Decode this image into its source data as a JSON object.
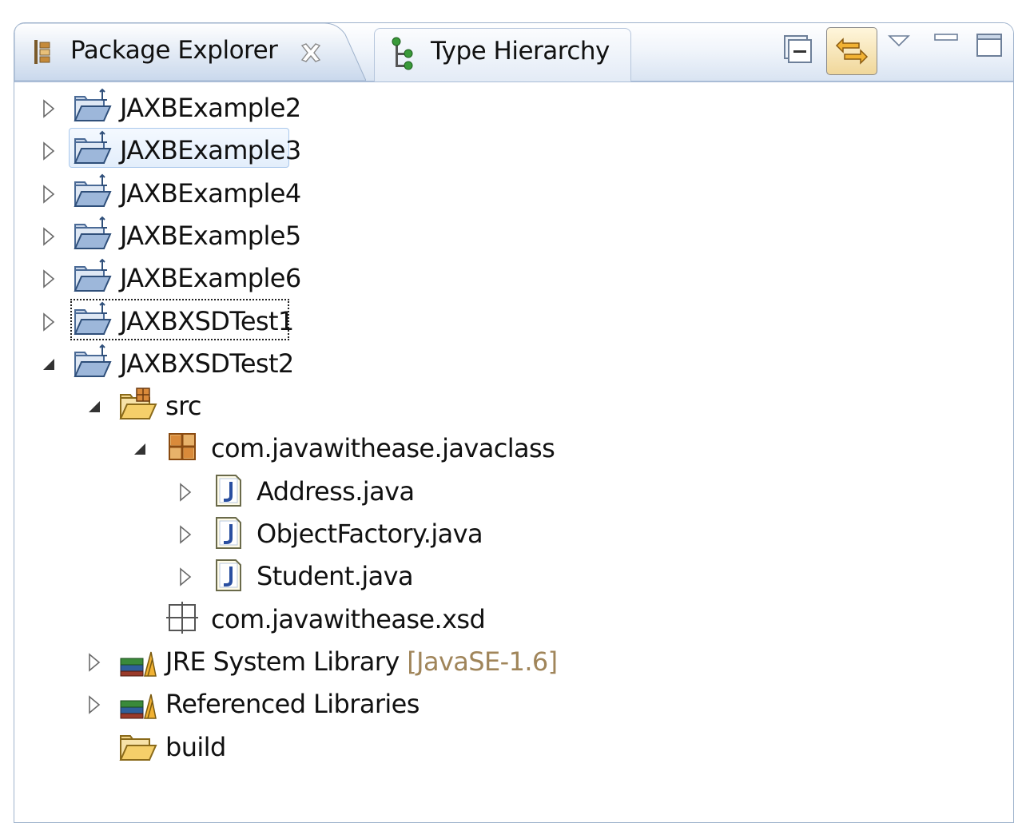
{
  "tabs": [
    {
      "label": "Package Explorer",
      "active": true
    },
    {
      "label": "Type Hierarchy",
      "active": false
    }
  ],
  "toolbar": {
    "collapse_all": "collapse-all-icon",
    "link_with_editor": "link-with-editor-icon",
    "view_menu": "view-menu-icon",
    "minimize": "minimize-icon",
    "maximize": "maximize-icon"
  },
  "tree": [
    {
      "label": "JAXBExample2",
      "icon": "project-folder-icon",
      "expanded": false,
      "depth": 0
    },
    {
      "label": "JAXBExample3",
      "icon": "project-folder-icon",
      "expanded": false,
      "depth": 0,
      "hover": true
    },
    {
      "label": "JAXBExample4",
      "icon": "project-folder-icon",
      "expanded": false,
      "depth": 0
    },
    {
      "label": "JAXBExample5",
      "icon": "project-folder-icon",
      "expanded": false,
      "depth": 0
    },
    {
      "label": "JAXBExample6",
      "icon": "project-folder-icon",
      "expanded": false,
      "depth": 0
    },
    {
      "label": "JAXBXSDTest1",
      "icon": "project-folder-icon",
      "expanded": false,
      "depth": 0,
      "focused": true
    },
    {
      "label": "JAXBXSDTest2",
      "icon": "project-folder-icon",
      "expanded": true,
      "depth": 0
    },
    {
      "label": "src",
      "icon": "source-folder-icon",
      "expanded": true,
      "depth": 1
    },
    {
      "label": "com.javawithease.javaclass",
      "icon": "package-icon",
      "expanded": true,
      "depth": 2
    },
    {
      "label": "Address.java",
      "icon": "java-file-icon",
      "expanded": false,
      "depth": 3
    },
    {
      "label": "ObjectFactory.java",
      "icon": "java-file-icon",
      "expanded": false,
      "depth": 3
    },
    {
      "label": "Student.java",
      "icon": "java-file-icon",
      "expanded": false,
      "depth": 3
    },
    {
      "label": "com.javawithease.xsd",
      "icon": "empty-package-icon",
      "expanded": null,
      "depth": 2
    },
    {
      "label": "JRE System Library",
      "decoration": "[JavaSE-1.6]",
      "icon": "library-icon",
      "expanded": false,
      "depth": 1
    },
    {
      "label": "Referenced Libraries",
      "icon": "library-icon",
      "expanded": false,
      "depth": 1
    },
    {
      "label": "build",
      "icon": "folder-icon",
      "expanded": null,
      "depth": 1
    }
  ],
  "colors": {
    "header_gradient_top": "#ffffff",
    "header_gradient_bottom": "#d9e4f2",
    "border": "#9eb2cc",
    "decoration_text": "#a0855a",
    "hover_fill": "#e3eefb"
  }
}
